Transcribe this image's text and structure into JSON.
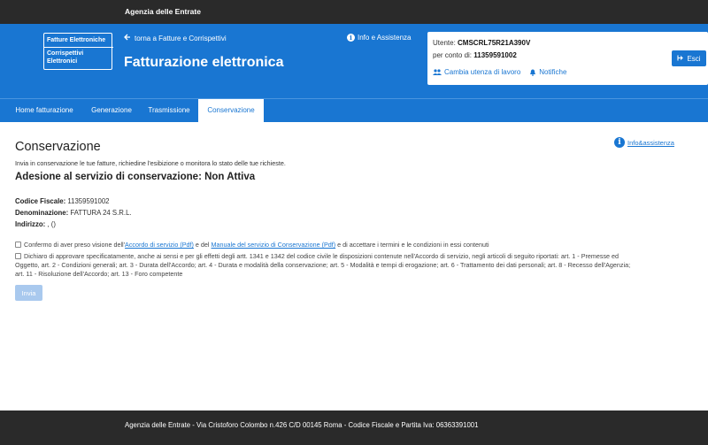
{
  "topbar": {
    "agency": "Agenzia delle Entrate"
  },
  "header": {
    "logo_line1": "Fatture Elettroniche",
    "logo_line2": "Corrispettivi Elettronici",
    "back_link": "torna a Fatture e Corrispettivi",
    "info_link": "Info e Assistenza",
    "title": "Fatturazione elettronica"
  },
  "user": {
    "label_user": "Utente:",
    "user_code": "CMSCRL75R21A390V",
    "label_on_behalf": "per conto di:",
    "on_behalf_code": "11359591002",
    "change_workspace": "Cambia utenza di lavoro",
    "notifications": "Notifiche",
    "exit": "Esci"
  },
  "tabs": [
    {
      "label": "Home fatturazione"
    },
    {
      "label": "Generazione"
    },
    {
      "label": "Trasmissione"
    },
    {
      "label": "Conservazione"
    }
  ],
  "main": {
    "title": "Conservazione",
    "subtitle": "Invia in conservazione le tue fatture, richiedine l'esibizione o monitora lo stato delle tue richieste.",
    "section_title": "Adesione al servizio di conservazione: Non Attiva",
    "info_link": "Info&assistenza",
    "fields": [
      {
        "label": "Codice Fiscale:",
        "value": "11359591002"
      },
      {
        "label": "Denominazione:",
        "value": "FATTURA 24 S.R.L."
      },
      {
        "label": "Indirizzo:",
        "value": ", ()"
      }
    ],
    "check1": {
      "pre": "Confermo di aver preso visione dell'",
      "link1": "Accordo di servizio (Pdf)",
      "mid": " e del ",
      "link2": "Manuale del servizio di Conservazione (Pdf)",
      "post": " e di accettare i termini e le condizioni in essi contenuti"
    },
    "check2": {
      "line1": "Dichiaro di approvare specificatamente, anche ai sensi e per gli effetti degli artt. 1341 e 1342 del codice civile le disposizioni contenute nell'Accordo di servizio, negli articoli di seguito riportati: art. 1 - Premesse ed",
      "line2": "Oggetto, art. 2 - Condizioni generali; art. 3 - Durata dell'Accordo; art. 4 - Durata e modalità della conservazione; art. 5 - Modalità e tempi di erogazione; art. 6 - Trattamento dei dati personali; art. 8 - Recesso dell'Agenzia;",
      "line3": "art. 11 - Risoluzione dell'Accordo; art. 13 - Foro competente"
    },
    "submit": "Invia"
  },
  "footer": {
    "text": "Agenzia delle Entrate - Via Cristoforo Colombo n.426 C/D 00145 Roma - Codice Fiscale e Partita Iva: 06363391001"
  }
}
